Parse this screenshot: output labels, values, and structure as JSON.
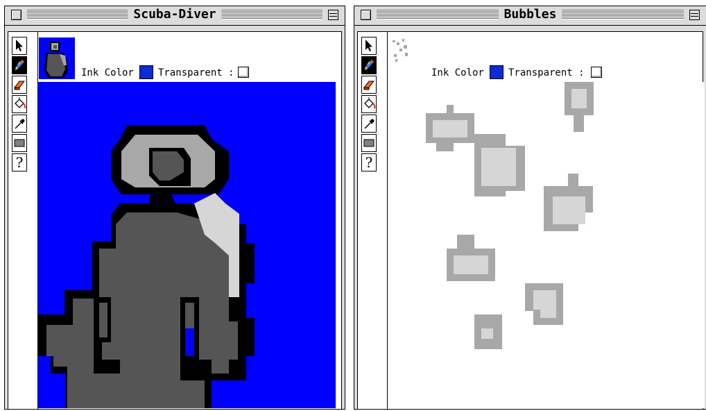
{
  "windows": [
    {
      "title": "Scuba-Diver",
      "ink_color_label": "Ink Color :",
      "ink_color": "#0d2bd2",
      "transparent_label": "Transparent :",
      "transparent_checked": false,
      "canvas_background": "#0000ff"
    },
    {
      "title": "Bubbles",
      "ink_color_label": "Ink Color :",
      "ink_color": "#0d2bd2",
      "transparent_label": "Transparent :",
      "transparent_checked": false,
      "canvas_background": "#ffffff"
    }
  ],
  "tools": [
    {
      "name": "arrow-icon",
      "glyph": ""
    },
    {
      "name": "pencil-icon",
      "glyph": ""
    },
    {
      "name": "eraser-icon",
      "glyph": ""
    },
    {
      "name": "paint-bucket-icon",
      "glyph": ""
    },
    {
      "name": "eyedropper-icon",
      "glyph": ""
    },
    {
      "name": "pattern-icon",
      "glyph": ""
    },
    {
      "name": "help-icon",
      "glyph": "?"
    }
  ],
  "palette": {
    "black": "#000000",
    "dark_gray": "#555555",
    "mid_gray": "#a8a8a8",
    "light_gray": "#d6d6d6",
    "blue": "#0000ff"
  }
}
